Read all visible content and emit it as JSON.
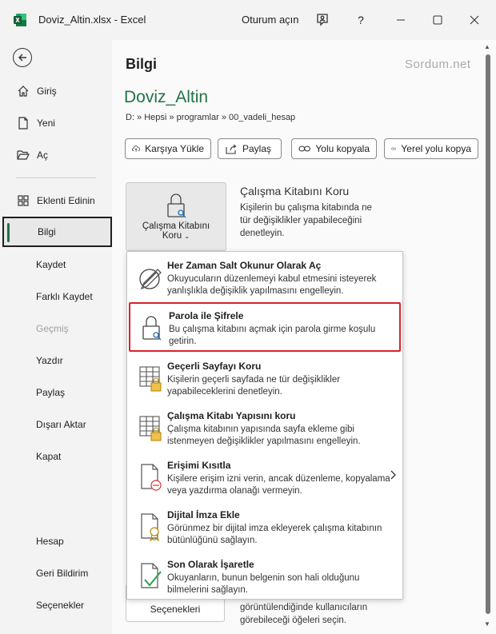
{
  "window": {
    "title": "Doviz_Altin.xlsx  -  Excel",
    "signin": "Oturum açın",
    "help": "?"
  },
  "nav": {
    "items": [
      {
        "label": "Giriş",
        "icon": "home-icon"
      },
      {
        "label": "Yeni",
        "icon": "new-document-icon"
      },
      {
        "label": "Aç",
        "icon": "folder-open-icon"
      },
      {
        "label": "Eklenti Edinin",
        "icon": "addins-grid-icon"
      },
      {
        "label": "Bilgi"
      },
      {
        "label": "Kaydet"
      },
      {
        "label": "Farklı Kaydet"
      },
      {
        "label": "Geçmiş"
      },
      {
        "label": "Yazdır"
      },
      {
        "label": "Paylaş"
      },
      {
        "label": "Dışarı Aktar"
      },
      {
        "label": "Kapat"
      },
      {
        "label": "Hesap"
      },
      {
        "label": "Geri Bildirim"
      },
      {
        "label": "Seçenekler"
      }
    ]
  },
  "main": {
    "heading": "Bilgi",
    "watermark": "Sordum.net",
    "doc_name": "Doviz_Altin",
    "doc_path": "D: » Hepsi » programlar » 00_vadeli_hesap",
    "actions": [
      {
        "label": "Karşıya Yükle",
        "icon": "upload-cloud-icon"
      },
      {
        "label": "Paylaş",
        "icon": "share-icon"
      },
      {
        "label": "Yolu kopyala",
        "icon": "link-icon"
      },
      {
        "label": "Yerel yolu kopya",
        "icon": "link-icon"
      }
    ],
    "protect": {
      "button_line1": "Çalışma Kitabını",
      "button_line2": "Koru",
      "title": "Çalışma Kitabını Koru",
      "description": "Kişilerin bu çalışma kitabında ne tür değişiklikler yapabileceğini denetleyin."
    },
    "bottom": {
      "button_label": "Seçenekleri",
      "description": "görüntülendiğinde kullanıcıların görebileceği öğeleri seçin."
    }
  },
  "menu": {
    "items": [
      {
        "title": "Her Zaman Salt Okunur Olarak Aç",
        "desc": "Okuyucuların düzenlemeyi kabul etmesini isteyerek yanlışlıkla değişiklik yapılmasını engelleyin."
      },
      {
        "title": "Parola ile Şifrele",
        "desc": "Bu çalışma kitabını açmak için parola girme koşulu getirin."
      },
      {
        "title": "Geçerli Sayfayı Koru",
        "desc": "Kişilerin geçerli sayfada ne tür değişiklikler yapabileceklerini denetleyin."
      },
      {
        "title": "Çalışma Kitabı Yapısını koru",
        "desc": "Çalışma kitabının yapısında sayfa ekleme gibi istenmeyen değişiklikler yapılmasını engelleyin."
      },
      {
        "title": "Erişimi Kısıtla",
        "desc": "Kişilere erişim izni verin, ancak düzenleme, kopyalama veya yazdırma olanağı vermeyin."
      },
      {
        "title": "Dijital İmza Ekle",
        "desc": "Görünmez bir dijital imza ekleyerek çalışma kitabının bütünlüğünü sağlayın."
      },
      {
        "title": "Son Olarak İşaretle",
        "desc": "Okuyanların, bunun belgenin son hali olduğunu bilmelerini sağlayın."
      }
    ]
  },
  "colors": {
    "excel_green": "#217346",
    "highlight_red": "#d9222a"
  }
}
